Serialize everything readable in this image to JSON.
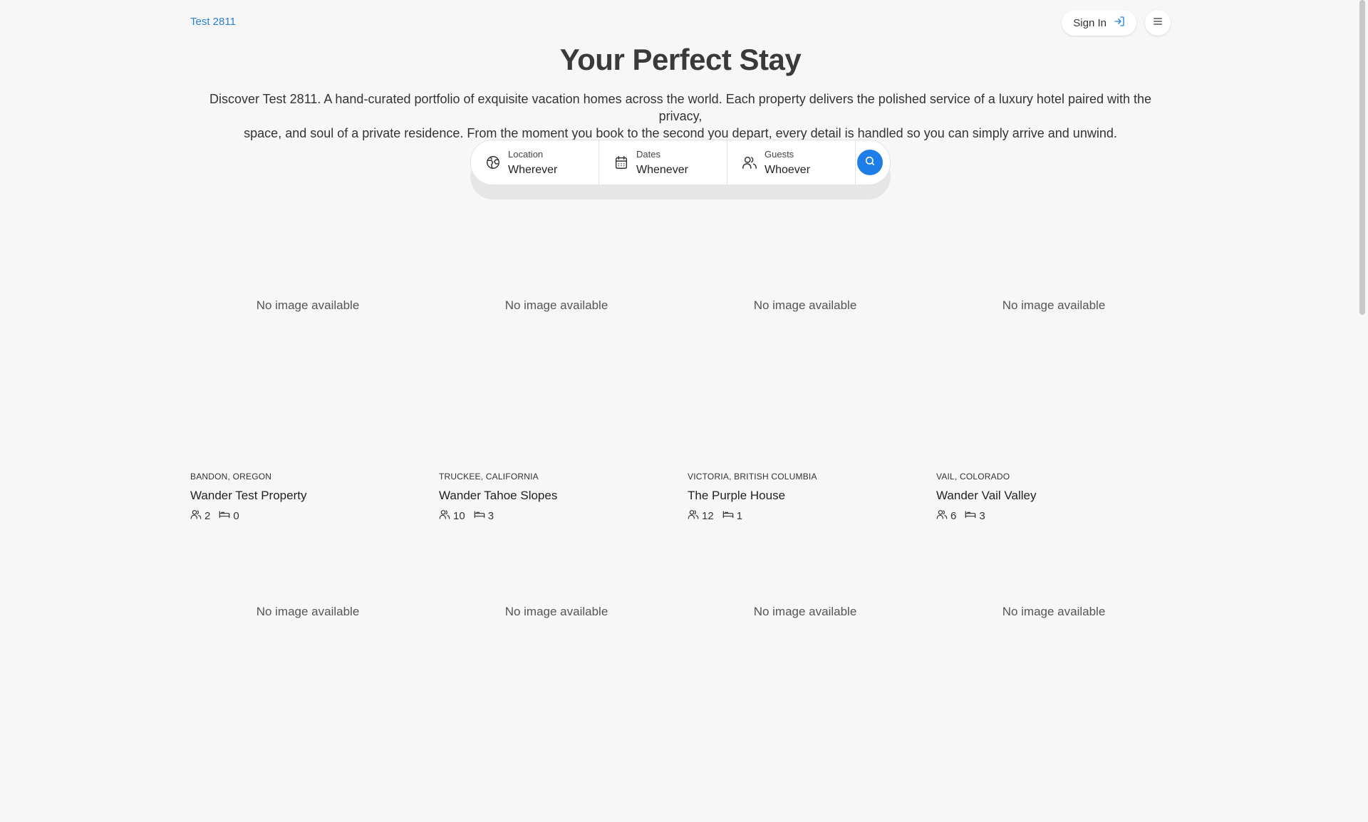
{
  "brand": "Test 2811",
  "header": {
    "signin_label": "Sign In"
  },
  "hero": {
    "title": "Your Perfect Stay",
    "intro_line1": "Discover Test 2811. A hand-curated portfolio of exquisite vacation homes across the world. Each property delivers the polished service of a luxury hotel paired with the privacy,",
    "intro_line2": "space, and soul of a private residence. From the moment you book to the second you depart, every detail is handled so you can simply arrive and unwind."
  },
  "search": {
    "location": {
      "label": "Location",
      "value": "Wherever"
    },
    "dates": {
      "label": "Dates",
      "value": "Whenever"
    },
    "guests": {
      "label": "Guests",
      "value": "Whoever"
    }
  },
  "colors": {
    "accent": "#1e7ee8",
    "brand": "#2b7fd8",
    "background": "#f7f7f7"
  },
  "no_image_text": "No image available",
  "properties": [
    {
      "location": "BANDON, OREGON",
      "name": "Wander Test Property",
      "guests": "2",
      "bedrooms": "0"
    },
    {
      "location": "TRUCKEE, CALIFORNIA",
      "name": "Wander Tahoe Slopes",
      "guests": "10",
      "bedrooms": "3"
    },
    {
      "location": "VICTORIA, BRITISH COLUMBIA",
      "name": "The Purple House",
      "guests": "12",
      "bedrooms": "1"
    },
    {
      "location": "VAIL, COLORADO",
      "name": "Wander Vail Valley",
      "guests": "6",
      "bedrooms": "3"
    },
    {
      "location": "",
      "name": "",
      "guests": "",
      "bedrooms": ""
    },
    {
      "location": "",
      "name": "",
      "guests": "",
      "bedrooms": ""
    },
    {
      "location": "",
      "name": "",
      "guests": "",
      "bedrooms": ""
    },
    {
      "location": "",
      "name": "",
      "guests": "",
      "bedrooms": ""
    }
  ]
}
